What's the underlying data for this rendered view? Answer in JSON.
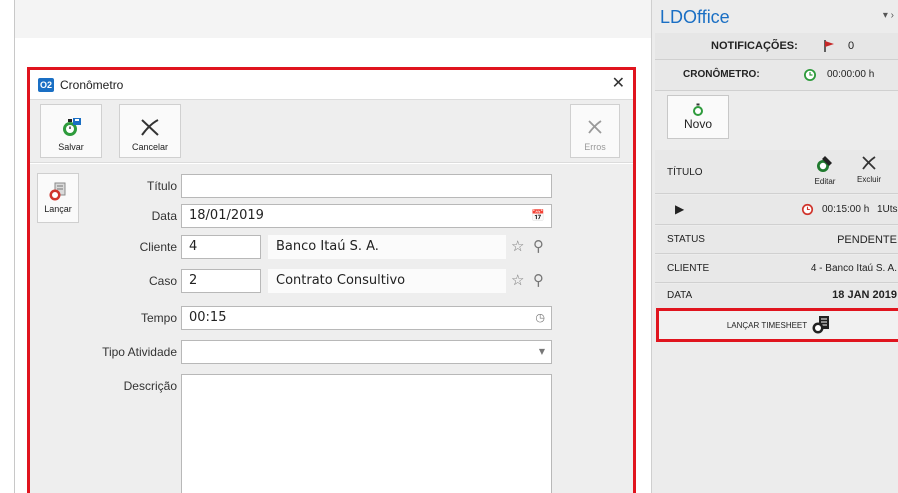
{
  "dialog": {
    "title": "Cronômetro",
    "app_icon": "O2",
    "close_glyph": "✕",
    "toolbar": {
      "salvar_label": "Salvar",
      "cancelar_label": "Cancelar",
      "erros_label": "Erros"
    },
    "lancar_label": "Lançar",
    "form": {
      "titulo_label": "Título",
      "titulo_value": "",
      "data_label": "Data",
      "data_value": "18/01/2019",
      "cliente_label": "Cliente",
      "cliente_code": "4",
      "cliente_name": "Banco Itaú S. A.",
      "caso_label": "Caso",
      "caso_code": "2",
      "caso_name": "Contrato Consultivo",
      "tempo_label": "Tempo",
      "tempo_value": "00:15",
      "tipo_atividade_label": "Tipo Atividade",
      "tipo_atividade_value": "",
      "descricao_label": "Descrição",
      "descricao_value": ""
    }
  },
  "panel": {
    "title": "LDOffice",
    "window_controls": "▾ ›",
    "notificacoes_label": "NOTIFICAÇÕES:",
    "notificacoes_count": "0",
    "cronometro_label": "CRONÔMETRO:",
    "cronometro_time": "00:00:00 h",
    "novo_label": "Novo",
    "titulo_header": "TÍTULO",
    "editar_label": "Editar",
    "excluir_label": "Excluir",
    "play_glyph": "▶",
    "entry_time": "00:15:00 h",
    "entry_units": "1Uts",
    "status_label": "STATUS",
    "status_value": "PENDENTE",
    "cliente_label": "CLIENTE",
    "cliente_value": "4 - Banco Itaú S. A.",
    "data_label": "DATA",
    "data_value": "18 JAN 2019",
    "lancar_timesheet_label": "LANÇAR TIMESHEET"
  },
  "colors": {
    "accent_blue": "#1a6fc4",
    "highlight_red": "#e0141e",
    "clock_red": "#d0342c",
    "clock_green": "#2e9b3c"
  }
}
